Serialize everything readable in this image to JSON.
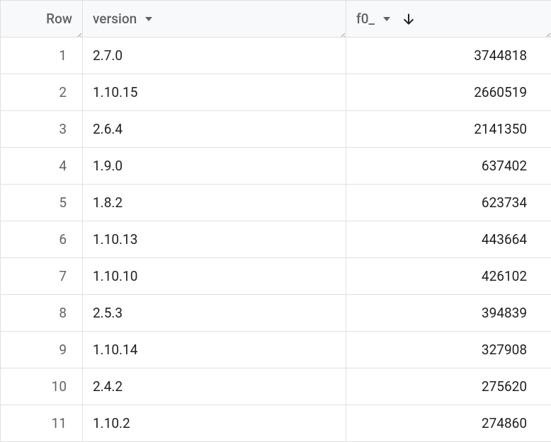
{
  "columns": {
    "row": {
      "label": "Row"
    },
    "version": {
      "label": "version"
    },
    "f0": {
      "label": "f0_"
    }
  },
  "rows": [
    {
      "n": "1",
      "version": "2.7.0",
      "f0": "3744818"
    },
    {
      "n": "2",
      "version": "1.10.15",
      "f0": "2660519"
    },
    {
      "n": "3",
      "version": "2.6.4",
      "f0": "2141350"
    },
    {
      "n": "4",
      "version": "1.9.0",
      "f0": "637402"
    },
    {
      "n": "5",
      "version": "1.8.2",
      "f0": "623734"
    },
    {
      "n": "6",
      "version": "1.10.13",
      "f0": "443664"
    },
    {
      "n": "7",
      "version": "1.10.10",
      "f0": "426102"
    },
    {
      "n": "8",
      "version": "2.5.3",
      "f0": "394839"
    },
    {
      "n": "9",
      "version": "1.10.14",
      "f0": "327908"
    },
    {
      "n": "10",
      "version": "2.4.2",
      "f0": "275620"
    },
    {
      "n": "11",
      "version": "1.10.2",
      "f0": "274860"
    }
  ]
}
